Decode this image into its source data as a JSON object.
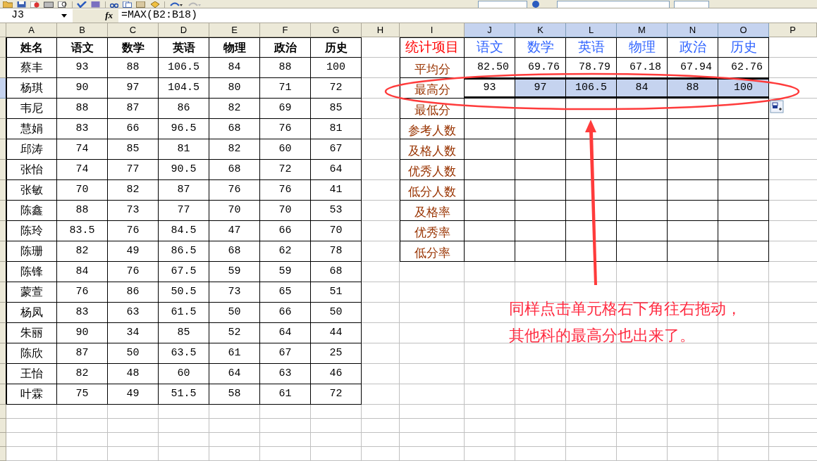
{
  "formula_bar": {
    "name_box": "J3",
    "fx_label": "fx",
    "formula": "=MAX(B2:B18)"
  },
  "column_headers": [
    {
      "label": "A",
      "selected": false
    },
    {
      "label": "B",
      "selected": false
    },
    {
      "label": "C",
      "selected": false
    },
    {
      "label": "D",
      "selected": false
    },
    {
      "label": "E",
      "selected": false
    },
    {
      "label": "F",
      "selected": false
    },
    {
      "label": "G",
      "selected": false
    },
    {
      "label": "H",
      "selected": false
    },
    {
      "label": "I",
      "selected": false
    },
    {
      "label": "J",
      "selected": true
    },
    {
      "label": "K",
      "selected": true
    },
    {
      "label": "L",
      "selected": true
    },
    {
      "label": "M",
      "selected": true
    },
    {
      "label": "N",
      "selected": true
    },
    {
      "label": "O",
      "selected": true
    },
    {
      "label": "P",
      "selected": false
    }
  ],
  "scores_table": {
    "header": [
      "姓名",
      "语文",
      "数学",
      "英语",
      "物理",
      "政治",
      "历史"
    ],
    "rows": [
      [
        "蔡丰",
        "93",
        "88",
        "106.5",
        "84",
        "88",
        "100"
      ],
      [
        "杨琪",
        "90",
        "97",
        "104.5",
        "80",
        "71",
        "72"
      ],
      [
        "韦尼",
        "88",
        "87",
        "86",
        "82",
        "69",
        "85"
      ],
      [
        "慧娟",
        "83",
        "66",
        "96.5",
        "68",
        "76",
        "81"
      ],
      [
        "邱涛",
        "74",
        "85",
        "81",
        "82",
        "60",
        "67"
      ],
      [
        "张怡",
        "74",
        "77",
        "90.5",
        "68",
        "72",
        "64"
      ],
      [
        "张敏",
        "70",
        "82",
        "87",
        "76",
        "76",
        "41"
      ],
      [
        "陈鑫",
        "88",
        "73",
        "77",
        "70",
        "70",
        "53"
      ],
      [
        "陈玲",
        "83.5",
        "76",
        "84.5",
        "47",
        "66",
        "70"
      ],
      [
        "陈珊",
        "82",
        "49",
        "86.5",
        "68",
        "62",
        "78"
      ],
      [
        "陈锋",
        "84",
        "76",
        "67.5",
        "59",
        "59",
        "68"
      ],
      [
        "蒙萱",
        "76",
        "86",
        "50.5",
        "73",
        "65",
        "51"
      ],
      [
        "杨凤",
        "83",
        "63",
        "61.5",
        "50",
        "66",
        "50"
      ],
      [
        "朱丽",
        "90",
        "34",
        "85",
        "52",
        "64",
        "44"
      ],
      [
        "陈欣",
        "87",
        "50",
        "63.5",
        "61",
        "67",
        "25"
      ],
      [
        "王怡",
        "82",
        "48",
        "60",
        "64",
        "63",
        "46"
      ],
      [
        "叶霖",
        "75",
        "49",
        "51.5",
        "58",
        "61",
        "72"
      ]
    ]
  },
  "stats_table": {
    "title": "统计项目",
    "subjects": [
      "语文",
      "数学",
      "英语",
      "物理",
      "政治",
      "历史"
    ],
    "rows": [
      {
        "label": "平均分",
        "cells": [
          {
            "text": "82.50",
            "selected": false,
            "active": false
          },
          {
            "text": "69.76",
            "selected": false,
            "active": false
          },
          {
            "text": "78.79",
            "selected": false,
            "active": false
          },
          {
            "text": "67.18",
            "selected": false,
            "active": false
          },
          {
            "text": "67.94",
            "selected": false,
            "active": false
          },
          {
            "text": "62.76",
            "selected": false,
            "active": false
          }
        ]
      },
      {
        "label": "最高分",
        "cells": [
          {
            "text": "93",
            "selected": true,
            "active": true
          },
          {
            "text": "97",
            "selected": true,
            "active": false
          },
          {
            "text": "106.5",
            "selected": true,
            "active": false
          },
          {
            "text": "84",
            "selected": true,
            "active": false
          },
          {
            "text": "88",
            "selected": true,
            "active": false
          },
          {
            "text": "100",
            "selected": true,
            "active": false
          }
        ]
      },
      {
        "label": "最低分"
      },
      {
        "label": "参考人数"
      },
      {
        "label": "及格人数"
      },
      {
        "label": "优秀人数"
      },
      {
        "label": "低分人数"
      },
      {
        "label": "及格率"
      },
      {
        "label": "优秀率"
      },
      {
        "label": "低分率"
      }
    ]
  },
  "annotation": {
    "lines": [
      "同样点击单元格右下角往右拖动，",
      "其他科的最高分也出来了。"
    ]
  }
}
